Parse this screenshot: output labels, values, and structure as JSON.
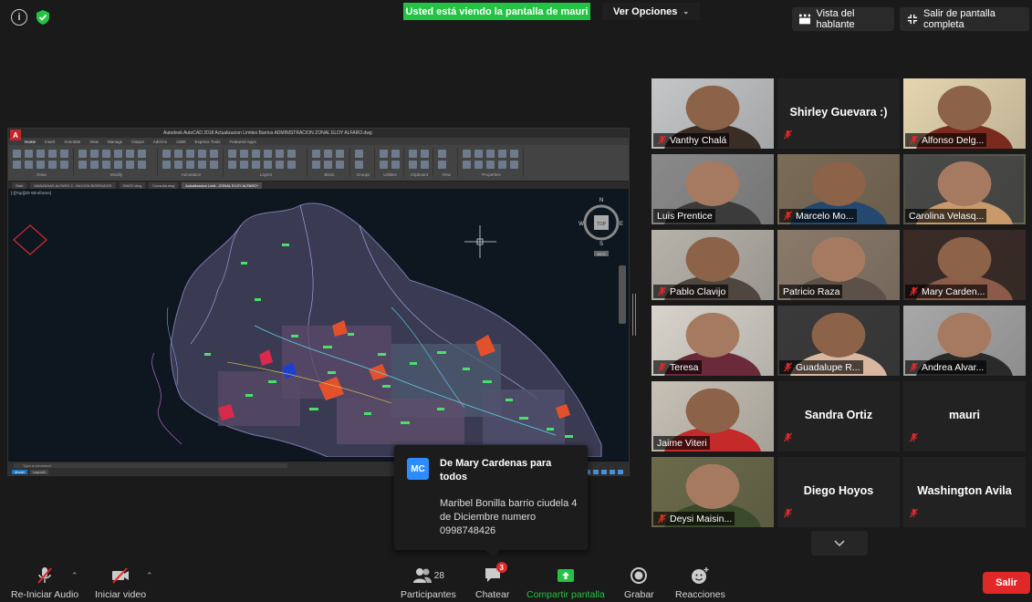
{
  "top": {
    "share_banner": "Usted está viendo la pantalla de mauri",
    "view_options": "Ver Opciones",
    "speaker_view": "Vista del hablante",
    "exit_fullscreen": "Salir de pantalla completa"
  },
  "cad": {
    "title": "Autodesk AutoCAD 2018   Actualizacion Limites Barrios ADMINISTRACION ZONAL ELOY ALFARO.dwg",
    "ribbon_tabs": [
      "Home",
      "Insert",
      "Annotate",
      "View",
      "Manage",
      "Output",
      "Add-ins",
      "A360",
      "Express Tools",
      "Featured Apps"
    ],
    "ribbon_groups": [
      "Draw",
      "Modify",
      "Annotation",
      "Layers",
      "Block",
      "Groups",
      "Utilities",
      "Clipboard",
      "View",
      "Properties"
    ],
    "file_tabs": [
      "Start",
      "MANZANAS ALFARO 2...RACION BORRADOS",
      "DWG2.dwg",
      "Consulta.dwg",
      "Actualizacion Limit...ZONAL ELOY ALFARO*"
    ],
    "view_label": "[-][Top][2D Wireframe]",
    "command_prompt": "Type a command",
    "model_tabs": [
      "Model",
      "Layout1"
    ],
    "viewcube": {
      "top": "TOP",
      "n": "N",
      "s": "S",
      "e": "E",
      "w": "W",
      "wcs": "WCS"
    }
  },
  "gallery": {
    "tiles": [
      {
        "name": "Vanthy Chalá",
        "muted": true,
        "video": true
      },
      {
        "name": "Shirley Guevara :)",
        "muted": true,
        "video": false
      },
      {
        "name": "Alfonso Delg...",
        "muted": true,
        "video": true
      },
      {
        "name": "Luis Prentice",
        "muted": false,
        "video": true
      },
      {
        "name": "Marcelo Mo...",
        "muted": true,
        "video": true
      },
      {
        "name": "Carolina Velasq...",
        "muted": false,
        "video": true,
        "active": true
      },
      {
        "name": "Pablo Clavijo",
        "muted": true,
        "video": true
      },
      {
        "name": "Patricio Raza",
        "muted": false,
        "video": true
      },
      {
        "name": "Mary Carden...",
        "muted": true,
        "video": true
      },
      {
        "name": "Teresa",
        "muted": true,
        "video": true
      },
      {
        "name": "Guadalupe R...",
        "muted": true,
        "video": true
      },
      {
        "name": "Andrea Alvar...",
        "muted": true,
        "video": true
      },
      {
        "name": "Jaime Viteri",
        "muted": false,
        "video": true
      },
      {
        "name": "Sandra Ortiz",
        "muted": true,
        "video": false
      },
      {
        "name": "mauri",
        "muted": true,
        "video": false
      },
      {
        "name": "Deysi Maisin...",
        "muted": true,
        "video": true
      },
      {
        "name": "Diego Hoyos",
        "muted": true,
        "video": false
      },
      {
        "name": "Washington Avila",
        "muted": true,
        "video": false
      }
    ]
  },
  "chat": {
    "avatar": "MC",
    "from": "De Mary Cardenas para todos",
    "message": "Maribel Bonilla barrio ciudela 4 de Diciembre numero 0998748426"
  },
  "toolbar": {
    "audio": "Re-Iniciar Audio",
    "video": "Iniciar video",
    "participants": "Participantes",
    "participants_count": "28",
    "chat": "Chatear",
    "chat_badge": "3",
    "share": "Compartir pantalla",
    "record": "Grabar",
    "reactions": "Reacciones",
    "leave": "Salir"
  },
  "colors": {
    "share_green": "#23c343",
    "leave_red": "#e02828",
    "active_speaker": "#d8e05b",
    "avatar_blue": "#2d8cff"
  }
}
